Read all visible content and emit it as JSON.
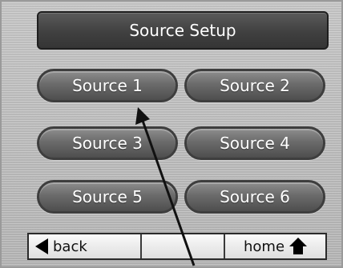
{
  "header": {
    "title": "Source Setup"
  },
  "sources": [
    {
      "label": "Source 1"
    },
    {
      "label": "Source 2"
    },
    {
      "label": "Source 3"
    },
    {
      "label": "Source 4"
    },
    {
      "label": "Source 5"
    },
    {
      "label": "Source 6"
    }
  ],
  "footer": {
    "back_label": "back",
    "home_label": "home"
  },
  "icons": {
    "back": "left-triangle-icon",
    "home": "house-icon",
    "pointer": "arrow-pointer-icon"
  }
}
